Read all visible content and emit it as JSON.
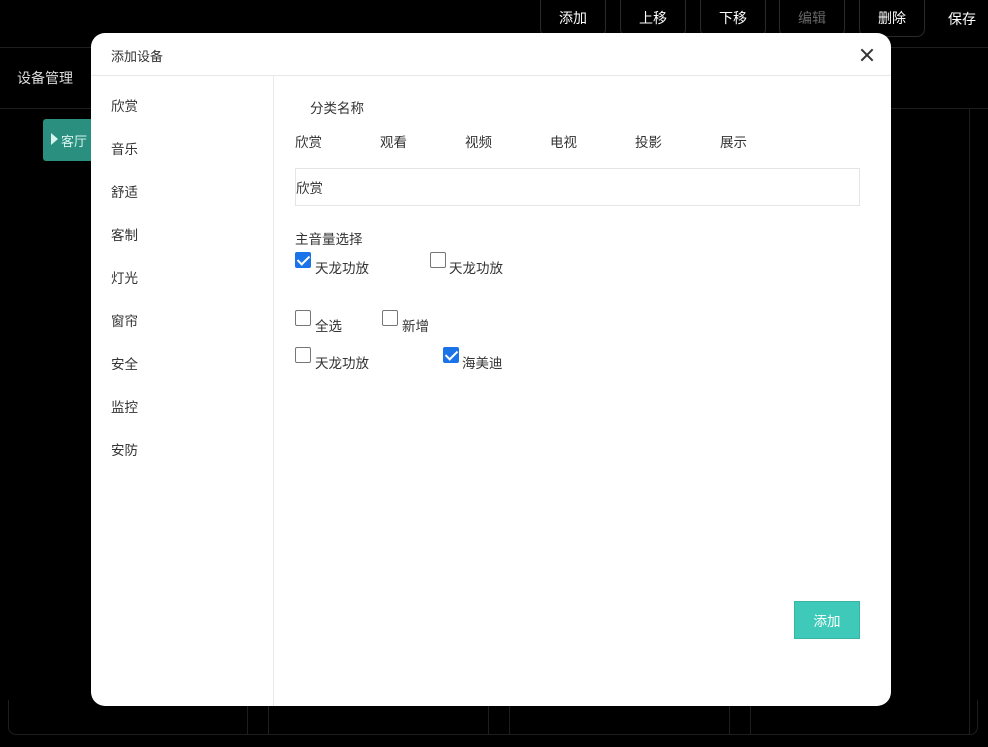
{
  "toolbar": {
    "add_label": "添加",
    "move_up_label": "上移",
    "move_down_label": "下移",
    "edit_label": "编辑",
    "delete_label": "删除",
    "save_label": "保存"
  },
  "page": {
    "sidebar_title": "设备管理",
    "room_tab_label": "客厅"
  },
  "modal": {
    "title": "添加设备",
    "categories": [
      "欣赏",
      "音乐",
      "舒适",
      "客制",
      "灯光",
      "窗帘",
      "安全",
      "监控",
      "安防"
    ],
    "category_name_label": "分类名称",
    "name_options": [
      "欣赏",
      "观看",
      "视频",
      "电视",
      "投影",
      "展示"
    ],
    "name_value": "欣赏",
    "main_volume_label": "主音量选择",
    "main_volume_options": [
      {
        "label": "天龙功放",
        "checked": true
      },
      {
        "label": "天龙功放",
        "checked": false
      }
    ],
    "select_all_label": "全选",
    "new_label": "新增",
    "device_options": [
      {
        "label": "天龙功放",
        "checked": false
      },
      {
        "label": "海美迪",
        "checked": true
      }
    ],
    "add_button_label": "添加"
  },
  "colors": {
    "accent": "#3ec9b9",
    "checkbox_checked": "#1a73e8",
    "background": "#000000"
  }
}
